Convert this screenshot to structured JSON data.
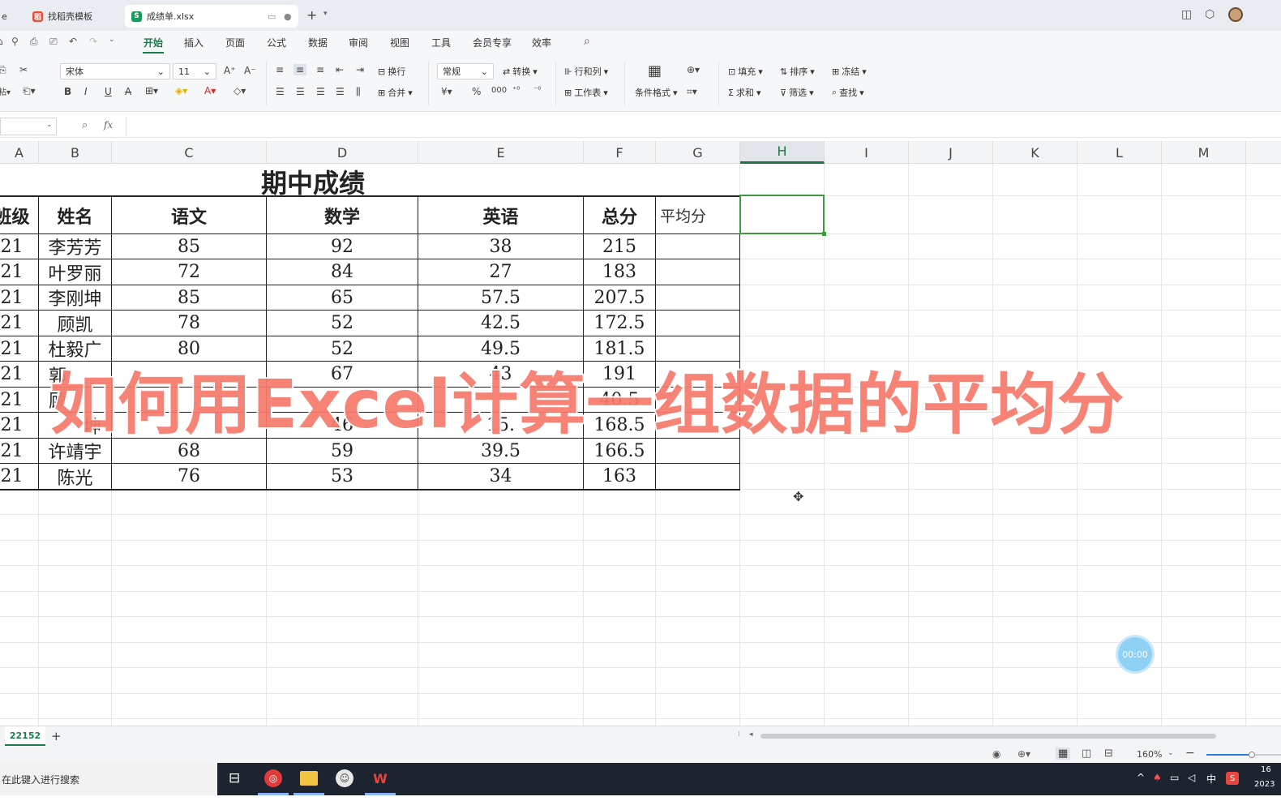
{
  "tabs": [
    {
      "label": "e"
    },
    {
      "label": "找稻壳模板",
      "icon": "稻"
    },
    {
      "label": "成绩单.xlsx",
      "icon": "S"
    }
  ],
  "menu": [
    "开始",
    "插入",
    "页面",
    "公式",
    "数据",
    "审阅",
    "视图",
    "工具",
    "会员专享",
    "效率"
  ],
  "ribbon": {
    "font_name": "宋体",
    "font_size": "11",
    "wrap": "换行",
    "merge": "合并",
    "format": "常规",
    "convert": "转换",
    "rowcol": "行和列",
    "worksheet": "工作表",
    "cond_format": "条件格式",
    "fill": "填充",
    "sort": "排序",
    "freeze": "冻结",
    "sum": "求和",
    "filter": "筛选",
    "find": "查找"
  },
  "formula": {
    "fx": "fx",
    "content": ""
  },
  "columns": [
    "A",
    "B",
    "C",
    "D",
    "E",
    "F",
    "G",
    "H",
    "I",
    "J",
    "K",
    "L",
    "M"
  ],
  "sheet": {
    "title": "期中成绩",
    "headers": [
      "班级",
      "姓名",
      "语文",
      "数学",
      "英语",
      "总分",
      "平均分"
    ],
    "rows": [
      [
        "21",
        "李芳芳",
        "85",
        "92",
        "38",
        "215"
      ],
      [
        "21",
        "叶罗丽",
        "72",
        "84",
        "27",
        "183"
      ],
      [
        "21",
        "李刚坤",
        "85",
        "65",
        "57.5",
        "207.5"
      ],
      [
        "21",
        "顾凯",
        "78",
        "52",
        "42.5",
        "172.5"
      ],
      [
        "21",
        "杜毅广",
        "80",
        "52",
        "49.5",
        "181.5"
      ],
      [
        "21",
        "郭",
        "",
        "67",
        "43",
        "191"
      ],
      [
        "21",
        "顾",
        "",
        "",
        "",
        "40.5"
      ],
      [
        "21",
        "坤",
        "",
        "46",
        "15.",
        "168.5"
      ],
      [
        "21",
        "许靖宇",
        "68",
        "59",
        "39.5",
        "166.5"
      ],
      [
        "21",
        "陈光",
        "76",
        "53",
        "34",
        "163"
      ]
    ]
  },
  "overlay_text": "如何用Excel计算一组数据的平均分",
  "timer": "00:00",
  "sheet_tab": "22152",
  "zoom": "160%",
  "taskbar": {
    "search": "在此键入进行搜索",
    "ime": "中",
    "clock_top": "16",
    "clock_bottom": "2023"
  },
  "colors": {
    "accent": "#1c7d4c",
    "overlay": "#f77a6c",
    "selected_cell": "#3f9a3f"
  }
}
